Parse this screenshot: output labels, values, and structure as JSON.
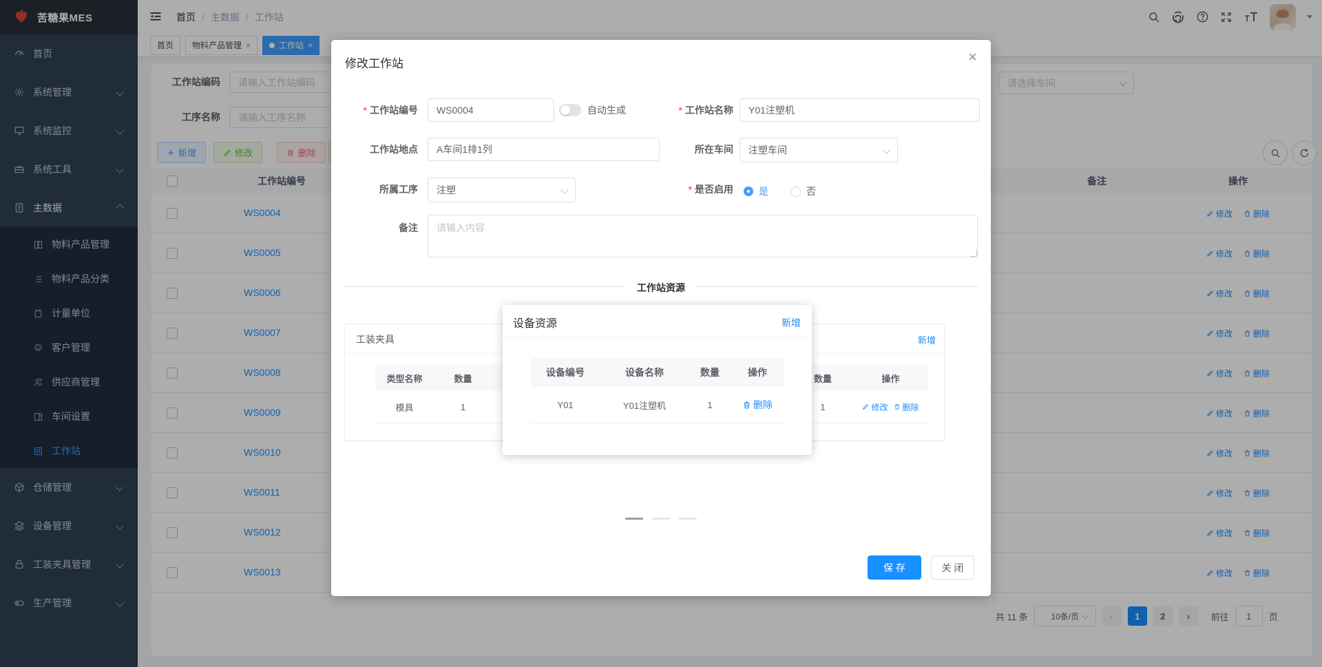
{
  "ui": {
    "close_glyph": "×",
    "required_mark": "*",
    "breadcrumb_sep": "/"
  },
  "colors": {
    "accent": "#409eff",
    "primary_button": "#1890ff",
    "link": "#1890ff",
    "sidebar_bg": "#304156",
    "submenu_bg": "#1f2d3d",
    "logo_bg": "#2b2f3a",
    "tab_active": "#409eff",
    "danger": "#f56c6c",
    "success": "#67c23a",
    "warning": "#e6a23c"
  },
  "app": {
    "logo_title": "苦糖果MES"
  },
  "navbar": {
    "breadcrumb": [
      "首页",
      "主数据",
      "工作站"
    ],
    "icons": [
      "search-icon",
      "github-icon",
      "help-icon",
      "fullscreen-icon",
      "font-size-icon",
      "avatar",
      "caret-down-icon"
    ]
  },
  "tabs": {
    "items": [
      {
        "label": "首页"
      },
      {
        "label": "物料产品管理"
      },
      {
        "label": "工作站"
      }
    ]
  },
  "sidebar": {
    "top": [
      {
        "label": "首页",
        "icon": "dashboard-icon"
      },
      {
        "label": "系统管理",
        "icon": "gear-icon"
      },
      {
        "label": "系统监控",
        "icon": "monitor-icon"
      },
      {
        "label": "系统工具",
        "icon": "toolbox-icon"
      },
      {
        "label": "主数据",
        "icon": "document-icon"
      }
    ],
    "sub": [
      {
        "label": "物料产品管理",
        "icon": "book-icon"
      },
      {
        "label": "物料产品分类",
        "icon": "list-icon"
      },
      {
        "label": "计量单位",
        "icon": "notebook-icon"
      },
      {
        "label": "客户管理",
        "icon": "customer-icon"
      },
      {
        "label": "供应商管理",
        "icon": "supplier-icon"
      },
      {
        "label": "车间设置",
        "icon": "workshop-icon"
      },
      {
        "label": "工作站",
        "icon": "workstation-icon"
      }
    ],
    "bottom": [
      {
        "label": "仓储管理",
        "icon": "warehouse-icon"
      },
      {
        "label": "设备管理",
        "icon": "layers-icon"
      },
      {
        "label": "工装夹具管理",
        "icon": "lock-icon"
      },
      {
        "label": "生产管理",
        "icon": "production-icon"
      }
    ]
  },
  "filters": {
    "code_label": "工作站编码",
    "code_placeholder": "请输入工作站编码",
    "process_label": "工序名称",
    "process_placeholder": "请输入工序名称",
    "workshop_placeholder": "请选择车间"
  },
  "toolbar": {
    "add": "新增",
    "edit": "修改",
    "delete": "删除"
  },
  "bgtable": {
    "header_code": "工作站编号",
    "header_remark": "备注",
    "header_actions": "操作",
    "edit": "修改",
    "delete": "删除",
    "rows": [
      {
        "code": "WS0004"
      },
      {
        "code": "WS0005"
      },
      {
        "code": "WS0006"
      },
      {
        "code": "WS0007"
      },
      {
        "code": "WS0008"
      },
      {
        "code": "WS0009"
      },
      {
        "code": "WS0010"
      },
      {
        "code": "WS0011"
      },
      {
        "code": "WS0012"
      },
      {
        "code": "WS0013"
      }
    ]
  },
  "pagination": {
    "total": "共 11 条",
    "page_size": "10条/页",
    "prev": "‹",
    "next": "›",
    "page1": "1",
    "page2": "2",
    "goto_label": "前往",
    "goto_value": "1",
    "goto_unit": "页"
  },
  "modal": {
    "title": "修改工作站",
    "fields": {
      "code": {
        "label": "工作站编号",
        "value": "WS0004"
      },
      "auto_generate_label": "自动生成",
      "name": {
        "label": "工作站名称",
        "value": "Y01注塑机"
      },
      "location": {
        "label": "工作站地点",
        "value": "A车间1排1列"
      },
      "workshop": {
        "label": "所在车间",
        "value": "注塑车间"
      },
      "process": {
        "label": "所属工序",
        "value": "注塑"
      },
      "enabled": {
        "label": "是否启用",
        "yes": "是",
        "no": "否",
        "selected": "是"
      },
      "remark": {
        "label": "备注",
        "placeholder": "请输入内容"
      }
    },
    "divider": "工作站资源",
    "save": "保 存",
    "close": "关 闭"
  },
  "fixture_panel": {
    "title": "工装夹具",
    "header_type": "类型名称",
    "header_qty": "数量",
    "row_type": "模具",
    "row_qty": "1",
    "edit": "修改"
  },
  "device_dialog": {
    "title": "设备资源",
    "add": "新增",
    "header_code": "设备编号",
    "header_name": "设备名称",
    "header_qty": "数量",
    "header_actions": "操作",
    "row_code": "Y01",
    "row_name": "Y01注塑机",
    "row_qty": "1",
    "delete": "删除"
  },
  "right_panel": {
    "add": "新增",
    "header_qty": "数量",
    "header_actions": "操作",
    "row_qty": "1",
    "edit": "修改",
    "delete": "删除"
  }
}
